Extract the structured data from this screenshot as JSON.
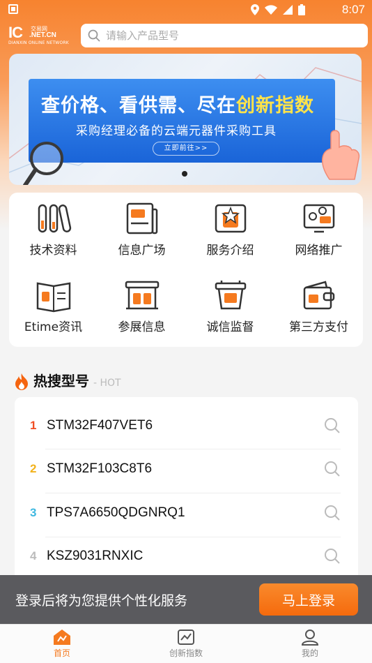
{
  "status_bar": {
    "time": "8:07"
  },
  "header": {
    "logo_main": "IC",
    "logo_tag": "交易网",
    "logo_domain": ".NET.CN",
    "logo_sub": "DIANXIN ONLINE NETWORK",
    "search_placeholder": "请输入产品型号"
  },
  "banner": {
    "title_part1": "查价格、看供需、尽在",
    "title_highlight": "创新指数",
    "subtitle": "采购经理必备的云端元器件采购工具",
    "cta": "立即前往>>"
  },
  "grid": {
    "items": [
      {
        "label": "技术资料",
        "icon": "tech-docs-icon"
      },
      {
        "label": "信息广场",
        "icon": "info-square-icon"
      },
      {
        "label": "服务介绍",
        "icon": "service-intro-icon"
      },
      {
        "label": "网络推广",
        "icon": "network-promo-icon"
      },
      {
        "label": "Etime资讯",
        "icon": "etime-news-icon"
      },
      {
        "label": "参展信息",
        "icon": "exhibition-icon"
      },
      {
        "label": "诚信监督",
        "icon": "integrity-icon"
      },
      {
        "label": "第三方支付",
        "icon": "payment-icon"
      }
    ]
  },
  "hot": {
    "title": "热搜型号",
    "suffix": "- HOT",
    "rows": [
      {
        "rank": "1",
        "model": "STM32F407VET6",
        "color": "#f04e23"
      },
      {
        "rank": "2",
        "model": "STM32F103C8T6",
        "color": "#f2b21b"
      },
      {
        "rank": "3",
        "model": "TPS7A6650QDGNRQ1",
        "color": "#3fb8e0"
      },
      {
        "rank": "4",
        "model": "KSZ9031RNXIC",
        "color": "#bbbbbb"
      }
    ]
  },
  "login_bar": {
    "text": "登录后将为您提供个性化服务",
    "button": "马上登录"
  },
  "tabs": [
    {
      "label": "首页",
      "active": true
    },
    {
      "label": "创新指数",
      "active": false
    },
    {
      "label": "我的",
      "active": false
    }
  ],
  "colors": {
    "accent": "#f57a1f",
    "banner_blue": "#1a64d8"
  }
}
